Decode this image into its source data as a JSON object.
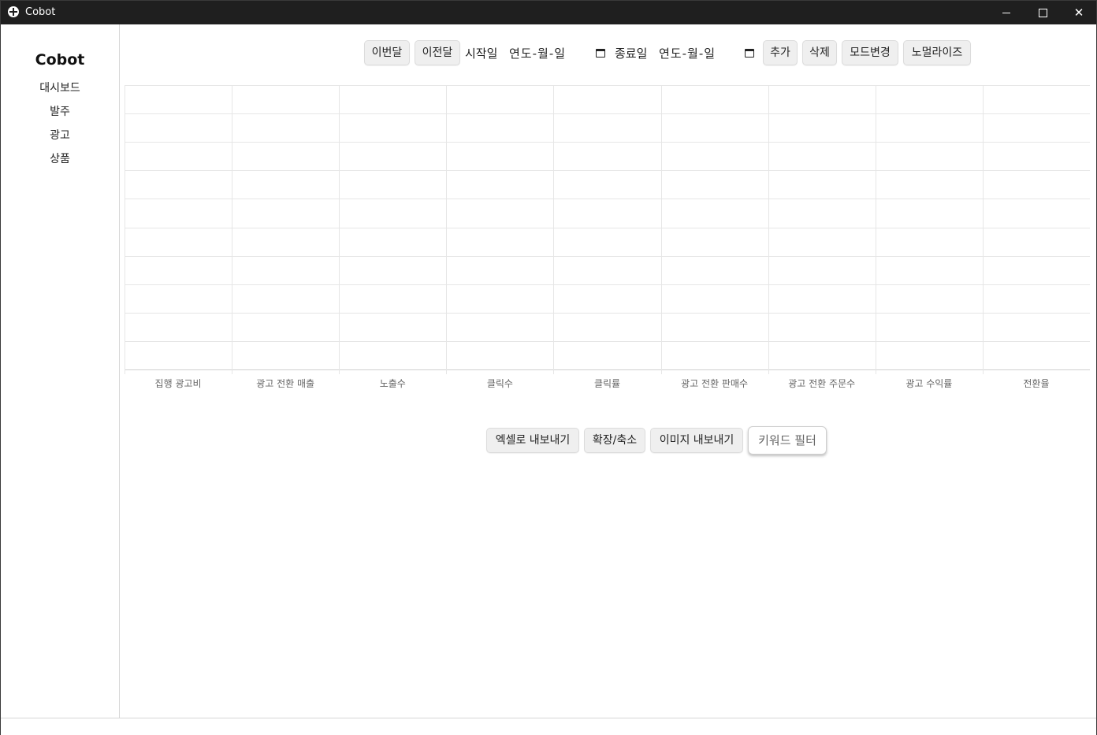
{
  "window": {
    "title": "Cobot",
    "controls": [
      "minimize",
      "maximize",
      "close"
    ],
    "close_glyph": "✕"
  },
  "sidebar": {
    "brand": "Cobot",
    "items": [
      {
        "label": "대시보드"
      },
      {
        "label": "발주"
      },
      {
        "label": "광고"
      },
      {
        "label": "상품"
      }
    ]
  },
  "toolbar": {
    "this_month": "이번달",
    "prev_month": "이전달",
    "start_label": "시작일",
    "start_placeholder": "연도-월-일",
    "end_label": "종료일",
    "end_placeholder": "연도-월-일",
    "add": "추가",
    "delete": "삭제",
    "mode_change": "모드변경",
    "normalize": "노멀라이즈",
    "calendar_icon": "calendar-icon"
  },
  "chart_data": {
    "type": "bar",
    "categories": [
      "집행 광고비",
      "광고 전환 매출",
      "노출수",
      "클릭수",
      "클릭률",
      "광고 전환 판매수",
      "광고 전환 주문수",
      "광고 수익률",
      "전환율"
    ],
    "series": [],
    "grid": true
  },
  "actions": {
    "export_excel": "엑셀로 내보내기",
    "zoom": "확장/축소",
    "export_image": "이미지 내보내기",
    "keyword_filter_placeholder": "키워드 필터"
  },
  "colors": {
    "titlebar": "#1f1f1f",
    "button_bg": "#efefef",
    "grid": "#e6e6e6"
  }
}
